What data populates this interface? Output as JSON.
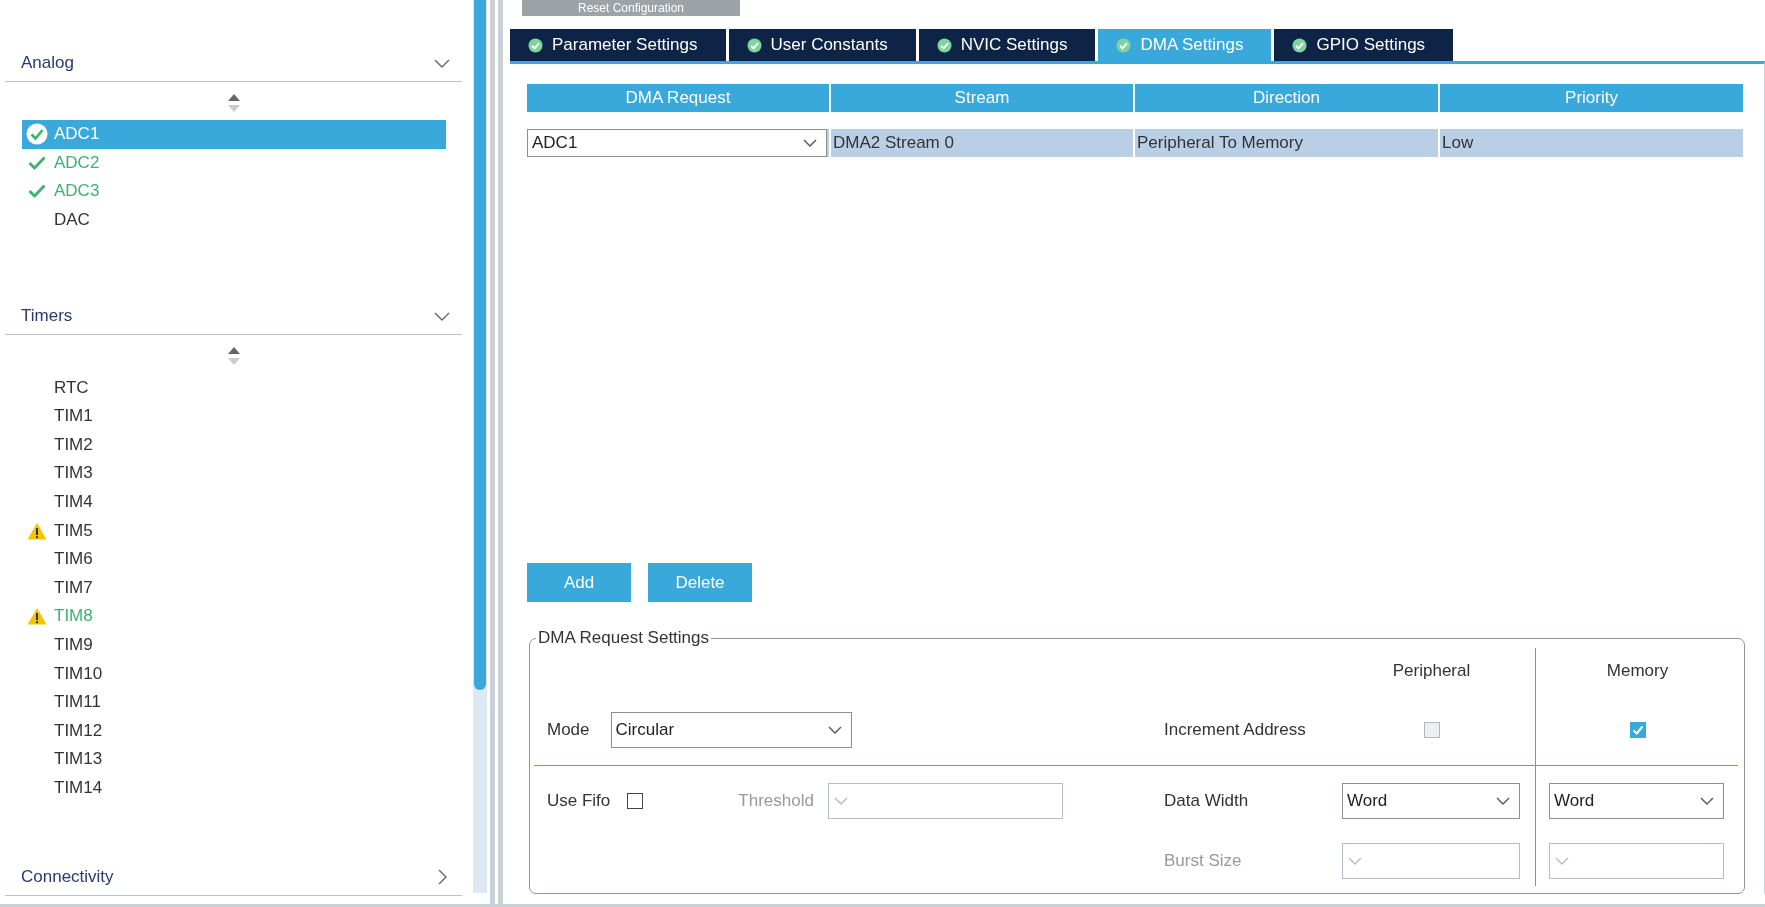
{
  "sidebar": {
    "groups": [
      {
        "title": "Analog",
        "expanded": true,
        "items": [
          {
            "label": "ADC1",
            "kind": "ok",
            "configured": true,
            "selected": true
          },
          {
            "label": "ADC2",
            "kind": "ok",
            "configured": true,
            "selected": false
          },
          {
            "label": "ADC3",
            "kind": "ok",
            "configured": true,
            "selected": false
          },
          {
            "label": "DAC",
            "kind": "plain",
            "configured": false,
            "selected": false
          }
        ]
      },
      {
        "title": "Timers",
        "expanded": true,
        "items": [
          {
            "label": "RTC",
            "kind": "plain",
            "configured": false,
            "selected": false
          },
          {
            "label": "TIM1",
            "kind": "plain",
            "configured": false,
            "selected": false
          },
          {
            "label": "TIM2",
            "kind": "plain",
            "configured": false,
            "selected": false
          },
          {
            "label": "TIM3",
            "kind": "plain",
            "configured": false,
            "selected": false
          },
          {
            "label": "TIM4",
            "kind": "plain",
            "configured": false,
            "selected": false
          },
          {
            "label": "TIM5",
            "kind": "warning",
            "configured": false,
            "selected": false
          },
          {
            "label": "TIM6",
            "kind": "plain",
            "configured": false,
            "selected": false
          },
          {
            "label": "TIM7",
            "kind": "plain",
            "configured": false,
            "selected": false
          },
          {
            "label": "TIM8",
            "kind": "warning",
            "configured": true,
            "selected": false
          },
          {
            "label": "TIM9",
            "kind": "plain",
            "configured": false,
            "selected": false
          },
          {
            "label": "TIM10",
            "kind": "plain",
            "configured": false,
            "selected": false
          },
          {
            "label": "TIM11",
            "kind": "plain",
            "configured": false,
            "selected": false
          },
          {
            "label": "TIM12",
            "kind": "plain",
            "configured": false,
            "selected": false
          },
          {
            "label": "TIM13",
            "kind": "plain",
            "configured": false,
            "selected": false
          },
          {
            "label": "TIM14",
            "kind": "plain",
            "configured": false,
            "selected": false
          }
        ]
      },
      {
        "title": "Connectivity",
        "expanded": false
      }
    ]
  },
  "reset_button": "Reset Configuration",
  "tabs": [
    {
      "label": "Parameter Settings",
      "selected": false
    },
    {
      "label": "User Constants",
      "selected": false
    },
    {
      "label": "NVIC Settings",
      "selected": false
    },
    {
      "label": "DMA Settings",
      "selected": true
    },
    {
      "label": "GPIO Settings",
      "selected": false
    }
  ],
  "table": {
    "columns": [
      "DMA Request",
      "Stream",
      "Direction",
      "Priority"
    ],
    "rows": [
      {
        "dma_request": "ADC1",
        "stream": "DMA2 Stream 0",
        "direction": "Peripheral To Memory",
        "priority": "Low",
        "selected": true
      }
    ]
  },
  "buttons": [
    "Add",
    "Delete"
  ],
  "settings": {
    "title": "DMA Request Settings",
    "mode": {
      "label": "Mode",
      "value": "Circular"
    },
    "use_fifo": {
      "label": "Use Fifo",
      "checked": false
    },
    "threshold": {
      "label": "Threshold",
      "disabled": true
    },
    "columns": [
      "Peripheral",
      "Memory"
    ],
    "increment_address": {
      "label": "Increment Address",
      "peripheral": {
        "checked": false,
        "disabled": true
      },
      "memory": {
        "checked": true,
        "disabled": false
      }
    },
    "data_width": {
      "label": "Data Width",
      "peripheral": "Word",
      "memory": "Word"
    },
    "burst_size": {
      "label": "Burst Size",
      "disabled": true
    }
  }
}
